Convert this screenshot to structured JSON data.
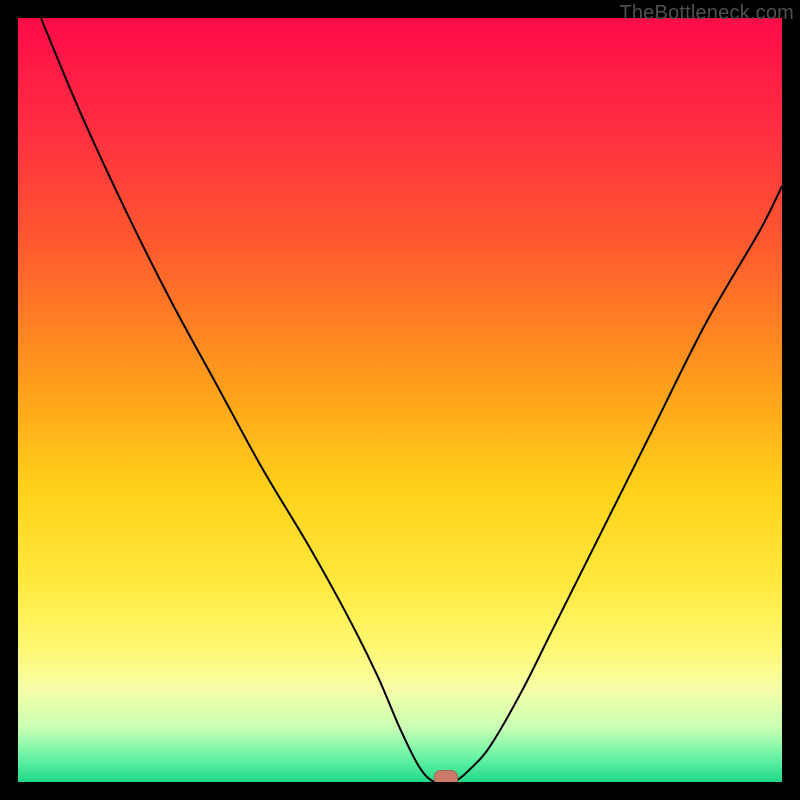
{
  "watermark": "TheBottleneck.com",
  "colors": {
    "frame": "#000000",
    "marker": "#c97a6a",
    "gradient_stops": [
      {
        "offset": 0.0,
        "color": "#ff0b49"
      },
      {
        "offset": 0.15,
        "color": "#ff2f41"
      },
      {
        "offset": 0.3,
        "color": "#ff5b2e"
      },
      {
        "offset": 0.48,
        "color": "#ff9e1b"
      },
      {
        "offset": 0.62,
        "color": "#ffd21a"
      },
      {
        "offset": 0.74,
        "color": "#ffe93e"
      },
      {
        "offset": 0.82,
        "color": "#fff86f"
      },
      {
        "offset": 0.88,
        "color": "#f6ffa8"
      },
      {
        "offset": 0.93,
        "color": "#c7ffb4"
      },
      {
        "offset": 0.97,
        "color": "#62f3a4"
      },
      {
        "offset": 1.0,
        "color": "#1fd989"
      }
    ]
  },
  "chart_data": {
    "type": "line",
    "title": "",
    "xlabel": "",
    "ylabel": "",
    "xlim": [
      0,
      100
    ],
    "ylim": [
      0,
      100
    ],
    "grid": false,
    "series": [
      {
        "name": "bottleneck-curve",
        "x": [
          3,
          8,
          14,
          20,
          26,
          32,
          38,
          43,
          47,
          50,
          52.5,
          54.5,
          57,
          59.5,
          62,
          66,
          70,
          76,
          83,
          90,
          97,
          100
        ],
        "y": [
          100,
          88,
          75,
          63,
          52,
          41,
          31,
          22,
          14,
          7,
          2,
          0,
          0,
          2,
          5,
          12,
          20,
          32,
          46,
          60,
          72,
          78
        ]
      }
    ],
    "marker": {
      "x": 56,
      "y": 0,
      "name": "optimal-point"
    },
    "notes": "y-axis is inverted visually: 0 at bottom (green), 100 at top (red). Values approximate; chart has no numeric tick labels."
  }
}
